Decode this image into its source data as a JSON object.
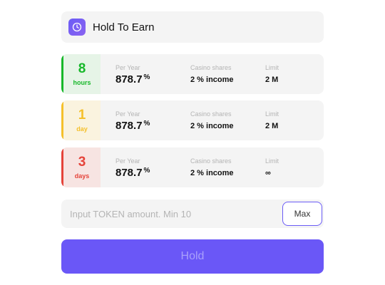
{
  "header": {
    "title": "Hold To Earn",
    "logo_icon": "purple-badge-icon"
  },
  "plans": [
    {
      "duration_value": "8",
      "duration_unit": "hours",
      "color": "#17b82a",
      "bg": "#e6f4e7",
      "per_year_label": "Per Year",
      "per_year_value": "878.7",
      "per_year_unit": "%",
      "shares_label": "Casino shares",
      "shares_value": "2 % income",
      "limit_label": "Limit",
      "limit_value": "2 M"
    },
    {
      "duration_value": "1",
      "duration_unit": "day",
      "color": "#f5c02b",
      "bg": "#faf3df",
      "per_year_label": "Per Year",
      "per_year_value": "878.7",
      "per_year_unit": "%",
      "shares_label": "Casino shares",
      "shares_value": "2 % income",
      "limit_label": "Limit",
      "limit_value": "2 M"
    },
    {
      "duration_value": "3",
      "duration_unit": "days",
      "color": "#e5433a",
      "bg": "#f7e4e2",
      "per_year_label": "Per Year",
      "per_year_value": "878.7",
      "per_year_unit": "%",
      "shares_label": "Casino shares",
      "shares_value": "2 % income",
      "limit_label": "Limit",
      "limit_value": "∞"
    }
  ],
  "amount_input": {
    "placeholder": "Input TOKEN amount. Min 10",
    "value": ""
  },
  "max_button": {
    "label": "Max"
  },
  "hold_button": {
    "label": "Hold"
  },
  "colors": {
    "accent": "#6a57f7"
  }
}
